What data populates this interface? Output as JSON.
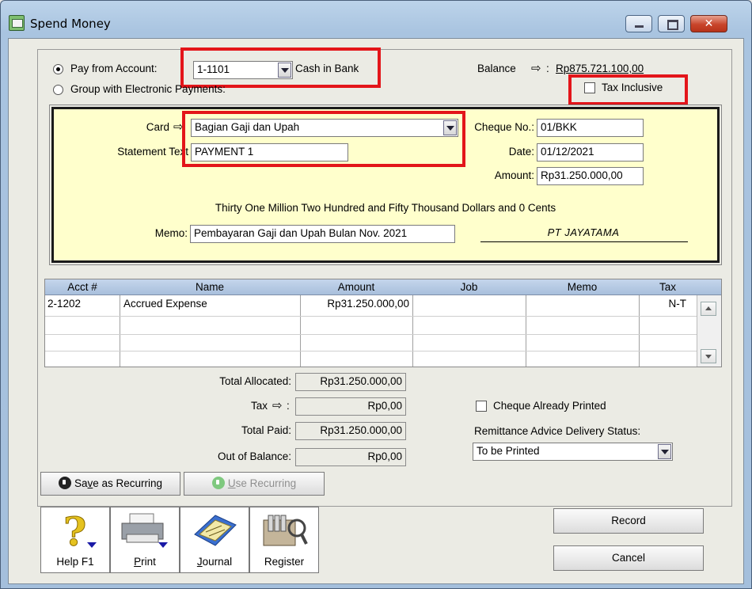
{
  "window": {
    "title": "Spend Money"
  },
  "pay_from": {
    "radio_pay_label": "Pay from Account:",
    "account_number": "1-1101",
    "account_name": "Cash in Bank",
    "radio_group_label": "Group with Electronic Payments:",
    "balance_label": "Balance",
    "balance_suffix": ":",
    "balance_value": "Rp875.721.100,00",
    "tax_inclusive_label": "Tax Inclusive",
    "tax_inclusive_checked": false
  },
  "cheque": {
    "card_label": "Card",
    "card_value": "Bagian Gaji dan Upah",
    "statement_label": "Statement Text",
    "statement_value": "PAYMENT 1",
    "cheque_no_label": "Cheque No.:",
    "cheque_no_value": "01/BKK",
    "date_label": "Date:",
    "date_value": "01/12/2021",
    "amount_label": "Amount:",
    "amount_value": "Rp31.250.000,00",
    "amount_words": "Thirty One Million Two Hundred and Fifty Thousand Dollars and 0 Cents",
    "memo_label": "Memo:",
    "memo_value": "Pembayaran Gaji dan Upah Bulan Nov. 2021",
    "signature": "PT JAYATAMA"
  },
  "grid": {
    "columns": [
      "Acct #",
      "Name",
      "Amount",
      "Job",
      "Memo",
      "Tax"
    ],
    "rows": [
      {
        "acct": "2-1202",
        "name": "Accrued Expense",
        "amount": "Rp31.250.000,00",
        "job": "",
        "memo": "",
        "tax": "N-T"
      }
    ]
  },
  "totals": {
    "allocated_label": "Total Allocated:",
    "allocated_value": "Rp31.250.000,00",
    "tax_label": "Tax",
    "tax_suffix": ":",
    "tax_value": "Rp0,00",
    "paid_label": "Total Paid:",
    "paid_value": "Rp31.250.000,00",
    "out_label": "Out of Balance:",
    "out_value": "Rp0,00"
  },
  "remittance": {
    "cheque_printed_label": "Cheque Already Printed",
    "cheque_printed_checked": false,
    "status_label": "Remittance Advice Delivery Status:",
    "status_value": "To be Printed"
  },
  "recurring": {
    "save_pre": "Sa",
    "save_u": "v",
    "save_post": "e as Recurring",
    "use_u": "U",
    "use_post": "se Recurring"
  },
  "toolbar": {
    "help_label": "Help F1",
    "print_u": "P",
    "print_post": "rint",
    "journal_u": "J",
    "journal_post": "ournal",
    "register_label": "Register"
  },
  "actions": {
    "record_label": "Record",
    "cancel_label": "Cancel"
  },
  "colors": {
    "highlight": "#e3151a",
    "cheque_bg": "#ffffcc"
  }
}
